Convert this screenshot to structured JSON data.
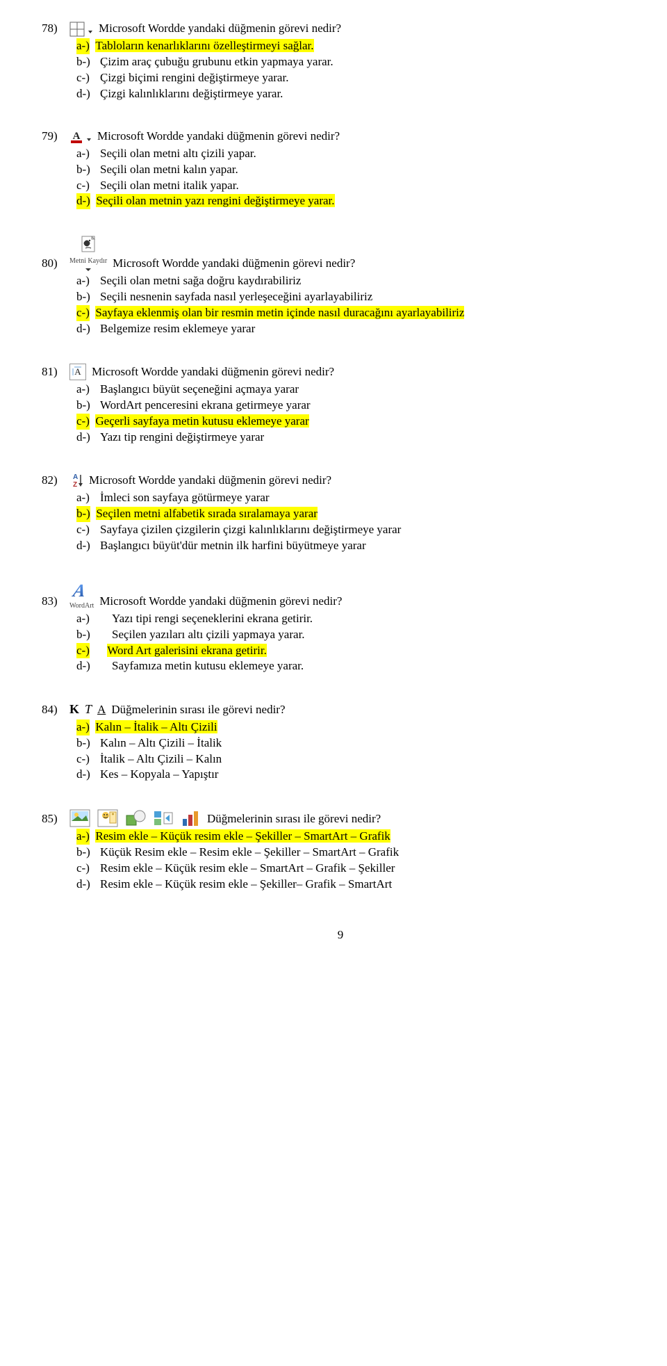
{
  "q78": {
    "num": "78)",
    "text": "Microsoft Wordde yandaki düğmenin görevi nedir?",
    "a": {
      "label": "a-)",
      "text": "Tabloların kenarlıklarını özelleştirmeyi sağlar."
    },
    "b": {
      "label": "b-)",
      "text": "Çizim araç çubuğu grubunu etkin yapmaya yarar."
    },
    "c": {
      "label": "c-)",
      "text": "Çizgi biçimi rengini değiştirmeye yarar."
    },
    "d": {
      "label": "d-)",
      "text": "Çizgi kalınlıklarını değiştirmeye yarar."
    }
  },
  "q79": {
    "num": "79)",
    "text": "Microsoft Wordde yandaki düğmenin görevi nedir?",
    "a": {
      "label": "a-)",
      "text": "Seçili olan metni altı çizili yapar."
    },
    "b": {
      "label": "b-)",
      "text": "Seçili olan metni kalın yapar."
    },
    "c": {
      "label": "c-)",
      "text": "Seçili olan metni italik yapar."
    },
    "d": {
      "label": "d-)",
      "text": "Seçili olan metnin yazı rengini değiştirmeye yarar."
    }
  },
  "q80": {
    "num": "80)",
    "text": "Microsoft Wordde yandaki düğmenin görevi nedir?",
    "iconLabel": "Metni Kaydır",
    "a": {
      "label": "a-)",
      "text": "Seçili olan metni sağa doğru kaydırabiliriz"
    },
    "b": {
      "label": "b-)",
      "text": "Seçili nesnenin sayfada nasıl yerleşeceğini ayarlayabiliriz"
    },
    "c": {
      "label": "c-)",
      "text": "Sayfaya eklenmiş olan bir resmin metin içinde nasıl duracağını ayarlayabiliriz"
    },
    "d": {
      "label": "d-)",
      "text": "Belgemize resim eklemeye yarar"
    }
  },
  "q81": {
    "num": "81)",
    "text": "Microsoft Wordde yandaki düğmenin görevi nedir?",
    "a": {
      "label": "a-)",
      "text": "Başlangıcı büyüt seçeneğini açmaya yarar"
    },
    "b": {
      "label": "b-)",
      "text": "WordArt penceresini ekrana getirmeye yarar"
    },
    "c": {
      "label": "c-)",
      "text": "Geçerli sayfaya metin kutusu eklemeye yarar"
    },
    "d": {
      "label": "d-)",
      "text": "Yazı tip rengini değiştirmeye yarar"
    }
  },
  "q82": {
    "num": "82)",
    "text": "Microsoft Wordde yandaki düğmenin görevi nedir?",
    "a": {
      "label": "a-)",
      "text": "İmleci son sayfaya götürmeye yarar"
    },
    "b": {
      "label": "b-)",
      "text": "Seçilen metni alfabetik sırada sıralamaya yarar"
    },
    "c": {
      "label": "c-)",
      "text": "Sayfaya çizilen çizgilerin çizgi kalınlıklarını değiştirmeye yarar"
    },
    "d": {
      "label": "d-)",
      "text": "Başlangıcı büyüt'dür metnin ilk harfini büyütmeye yarar"
    }
  },
  "q83": {
    "num": "83)",
    "text": "Microsoft Wordde yandaki düğmenin görevi nedir?",
    "iconLabel": "WordArt",
    "a": {
      "label": "a-)",
      "text": "Yazı tipi rengi seçeneklerini ekrana getirir."
    },
    "b": {
      "label": "b-)",
      "text": "Seçilen yazıları altı çizili yapmaya yarar."
    },
    "c": {
      "label": "c-)",
      "text": "Word Art galerisini ekrana getirir."
    },
    "d": {
      "label": "d-)",
      "text": "Sayfamıza metin kutusu eklemeye yarar."
    }
  },
  "q84": {
    "num": "84)",
    "text": "Düğmelerinin sırası ile görevi nedir?",
    "a": {
      "label": "a-)",
      "text": "Kalın – İtalik – Altı Çizili"
    },
    "b": {
      "label": "b-)",
      "text": "Kalın – Altı Çizili – İtalik"
    },
    "c": {
      "label": "c-)",
      "text": "İtalik – Altı Çizili – Kalın"
    },
    "d": {
      "label": "d-)",
      "text": "Kes – Kopyala – Yapıştır"
    }
  },
  "q85": {
    "num": "85)",
    "text": "Düğmelerinin sırası ile görevi nedir?",
    "a": {
      "label": "a-)",
      "text": "Resim ekle – Küçük resim ekle – Şekiller – SmartArt – Grafik"
    },
    "b": {
      "label": "b-)",
      "text": "Küçük Resim ekle – Resim ekle – Şekiller – SmartArt – Grafik"
    },
    "c": {
      "label": "c-)",
      "text": "Resim ekle – Küçük resim ekle – SmartArt – Grafik – Şekiller"
    },
    "d": {
      "label": "d-)",
      "text": "Resim ekle – Küçük resim ekle – Şekiller– Grafik – SmartArt"
    }
  },
  "pageNumber": "9"
}
